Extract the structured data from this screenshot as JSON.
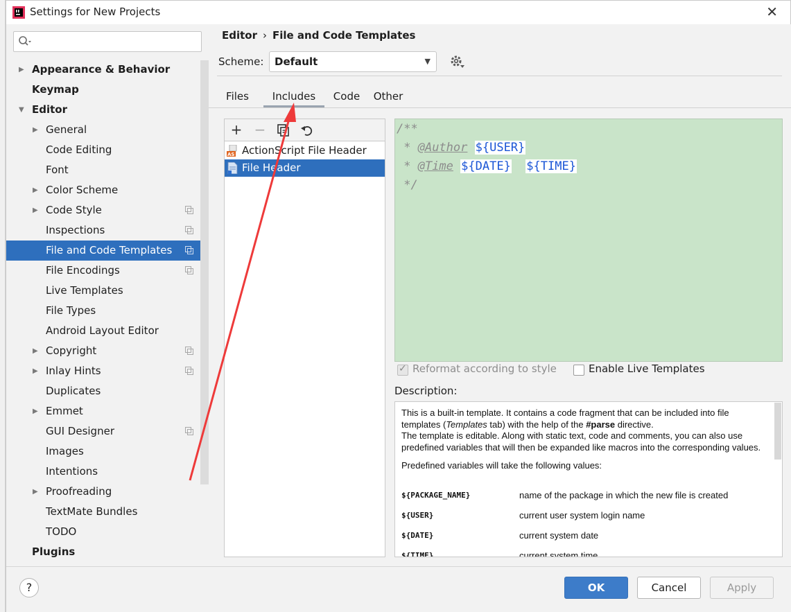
{
  "window": {
    "title": "Settings for New Projects",
    "close_label": "✕",
    "app_icon": "intellij-icon"
  },
  "search": {
    "placeholder": "",
    "icon": "search-icon"
  },
  "sidebar": {
    "items": [
      {
        "label": "Appearance & Behavior",
        "level": 0,
        "bold": true,
        "arrow": "▶",
        "copy": false,
        "selected": false
      },
      {
        "label": "Keymap",
        "level": 0,
        "bold": true,
        "arrow": "",
        "copy": false,
        "selected": false
      },
      {
        "label": "Editor",
        "level": 0,
        "bold": true,
        "arrow": "▼",
        "copy": false,
        "selected": false
      },
      {
        "label": "General",
        "level": 1,
        "bold": false,
        "arrow": "▶",
        "copy": false,
        "selected": false
      },
      {
        "label": "Code Editing",
        "level": 1,
        "bold": false,
        "arrow": "",
        "copy": false,
        "selected": false
      },
      {
        "label": "Font",
        "level": 1,
        "bold": false,
        "arrow": "",
        "copy": false,
        "selected": false
      },
      {
        "label": "Color Scheme",
        "level": 1,
        "bold": false,
        "arrow": "▶",
        "copy": false,
        "selected": false
      },
      {
        "label": "Code Style",
        "level": 1,
        "bold": false,
        "arrow": "▶",
        "copy": true,
        "selected": false
      },
      {
        "label": "Inspections",
        "level": 1,
        "bold": false,
        "arrow": "",
        "copy": true,
        "selected": false
      },
      {
        "label": "File and Code Templates",
        "level": 1,
        "bold": false,
        "arrow": "",
        "copy": true,
        "selected": true
      },
      {
        "label": "File Encodings",
        "level": 1,
        "bold": false,
        "arrow": "",
        "copy": true,
        "selected": false
      },
      {
        "label": "Live Templates",
        "level": 1,
        "bold": false,
        "arrow": "",
        "copy": false,
        "selected": false
      },
      {
        "label": "File Types",
        "level": 1,
        "bold": false,
        "arrow": "",
        "copy": false,
        "selected": false
      },
      {
        "label": "Android Layout Editor",
        "level": 1,
        "bold": false,
        "arrow": "",
        "copy": false,
        "selected": false
      },
      {
        "label": "Copyright",
        "level": 1,
        "bold": false,
        "arrow": "▶",
        "copy": true,
        "selected": false
      },
      {
        "label": "Inlay Hints",
        "level": 1,
        "bold": false,
        "arrow": "▶",
        "copy": true,
        "selected": false
      },
      {
        "label": "Duplicates",
        "level": 1,
        "bold": false,
        "arrow": "",
        "copy": false,
        "selected": false
      },
      {
        "label": "Emmet",
        "level": 1,
        "bold": false,
        "arrow": "▶",
        "copy": false,
        "selected": false
      },
      {
        "label": "GUI Designer",
        "level": 1,
        "bold": false,
        "arrow": "",
        "copy": true,
        "selected": false
      },
      {
        "label": "Images",
        "level": 1,
        "bold": false,
        "arrow": "",
        "copy": false,
        "selected": false
      },
      {
        "label": "Intentions",
        "level": 1,
        "bold": false,
        "arrow": "",
        "copy": false,
        "selected": false
      },
      {
        "label": "Proofreading",
        "level": 1,
        "bold": false,
        "arrow": "▶",
        "copy": false,
        "selected": false
      },
      {
        "label": "TextMate Bundles",
        "level": 1,
        "bold": false,
        "arrow": "",
        "copy": false,
        "selected": false
      },
      {
        "label": "TODO",
        "level": 1,
        "bold": false,
        "arrow": "",
        "copy": false,
        "selected": false
      },
      {
        "label": "Plugins",
        "level": 0,
        "bold": true,
        "arrow": "",
        "copy": false,
        "selected": false
      }
    ]
  },
  "breadcrumb": {
    "parent": "Editor",
    "separator": "›",
    "current": "File and Code Templates"
  },
  "scheme": {
    "label": "Scheme:",
    "value": "Default",
    "gear_icon": "gear-icon"
  },
  "tabs": [
    {
      "label": "Files",
      "active": false
    },
    {
      "label": "Includes",
      "active": true
    },
    {
      "label": "Code",
      "active": false
    },
    {
      "label": "Other",
      "active": false
    }
  ],
  "list_toolbar": {
    "add": "+",
    "remove": "−",
    "copy_icon": "copy-icon",
    "reset_icon": "undo-icon"
  },
  "templates": [
    {
      "label": "ActionScript File Header",
      "icon": "actionscript-file-icon",
      "selected": false
    },
    {
      "label": "File Header",
      "icon": "file-icon",
      "selected": true
    }
  ],
  "editor": {
    "line1": "/**",
    "line2_prefix": " * ",
    "line2_tag": "@Author",
    "line2_var": "${USER}",
    "line3_prefix": " * ",
    "line3_tag": "@Time",
    "line3_var1": "${DATE}",
    "line3_var2": "${TIME}",
    "line4": " */"
  },
  "options": {
    "reformat_label": "Reformat according to style",
    "reformat_checked": true,
    "reformat_enabled": false,
    "live_templates_label": "Enable Live Templates",
    "live_templates_checked": false
  },
  "description": {
    "label": "Description:",
    "para1_a": "This is a built-in template. It contains a code fragment that can be included into file templates (",
    "para1_em": "Templates",
    "para1_b": " tab) with the help of the ",
    "para1_strong": "#parse",
    "para1_c": " directive.",
    "para2": "The template is editable. Along with static text, code and comments, you can also use predefined variables that will then be expanded like macros into the corresponding values.",
    "para3": "Predefined variables will take the following values:",
    "variables": [
      {
        "name": "${PACKAGE_NAME}",
        "desc": "name of the package in which the new file is created"
      },
      {
        "name": "${USER}",
        "desc": "current user system login name"
      },
      {
        "name": "${DATE}",
        "desc": "current system date"
      },
      {
        "name": "${TIME}",
        "desc": "current system time"
      }
    ]
  },
  "buttons": {
    "help": "?",
    "ok": "OK",
    "cancel": "Cancel",
    "apply": "Apply"
  },
  "colors": {
    "selection": "#2e6fbd",
    "editor_bg": "#c9e4c9",
    "annotation_arrow": "#ee3a3a"
  }
}
